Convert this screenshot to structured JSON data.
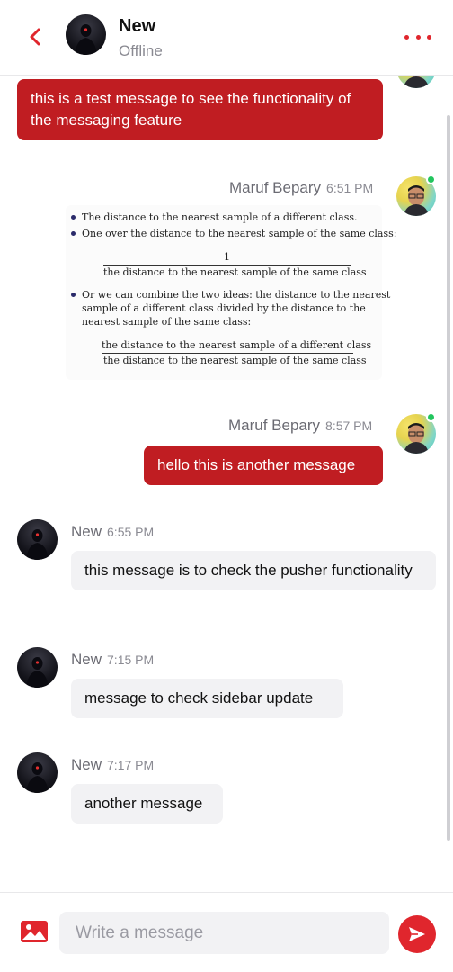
{
  "header": {
    "contact_name": "New",
    "status": "Offline"
  },
  "messages": [
    {
      "text": "this is a test message to see the functionality of the messaging feature"
    },
    {
      "sender": "Maruf Bepary",
      "time": "6:51 PM",
      "image_text": {
        "b1": "The distance to the nearest sample of a different class.",
        "b2": "One over the distance to the nearest sample of the same class:",
        "f1_num": "1",
        "f1_den": "the distance to the nearest sample of the same class",
        "b3_l1": "Or we can combine the two ideas:  the distance to the nearest",
        "b3_l2": "sample of a different class divided by the distance to the",
        "b3_l3": "nearest sample of the same class:",
        "f2_num": "the distance to the nearest sample of a different class",
        "f2_den": "the distance to the nearest sample of the same class"
      }
    },
    {
      "sender": "Maruf Bepary",
      "time": "8:57 PM",
      "text": "hello this is another message"
    },
    {
      "sender": "New",
      "time": "6:55 PM",
      "text": "this message is to check the pusher functionality"
    },
    {
      "sender": "New",
      "time": "7:15 PM",
      "text": "message to check sidebar update"
    },
    {
      "sender": "New",
      "time": "7:17 PM",
      "text": "another message"
    }
  ],
  "composer": {
    "placeholder": "Write a message"
  },
  "icons": {
    "back": "chevron-left-icon",
    "more": "more-dots-icon",
    "photo": "image-icon",
    "send": "send-icon"
  },
  "colors": {
    "accent": "#e0262d",
    "own_bubble": "#c01d22",
    "other_bubble": "#f2f2f4",
    "online": "#22c55e"
  }
}
